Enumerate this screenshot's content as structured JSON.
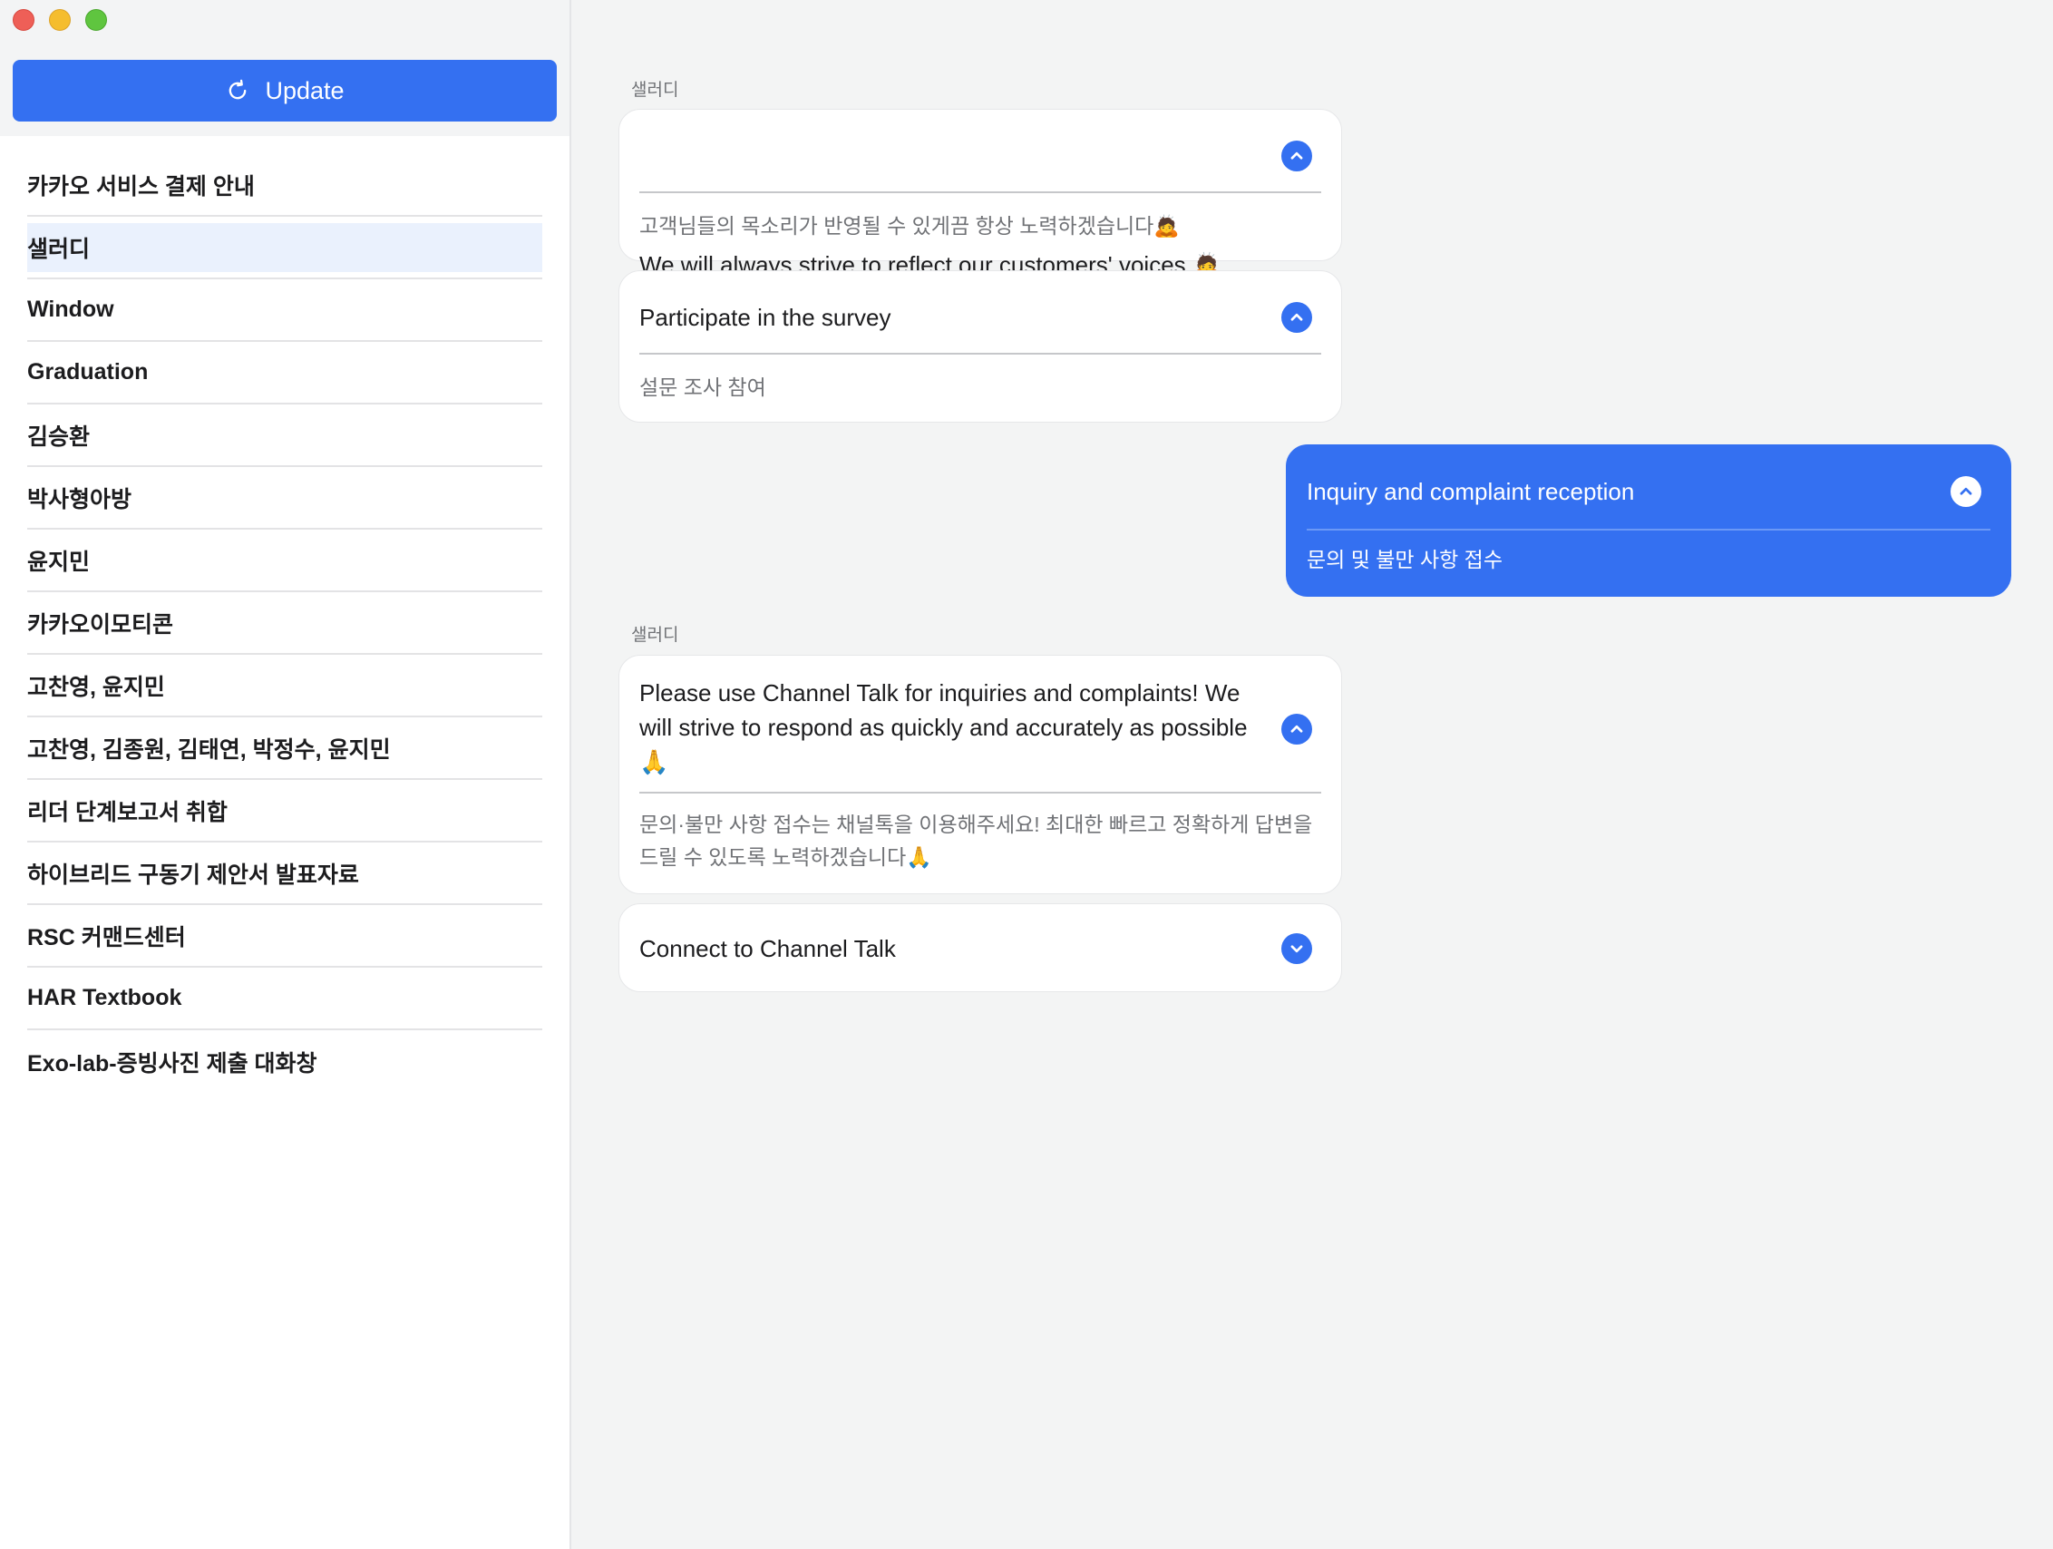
{
  "sidebar": {
    "update_label": "Update",
    "update_icon": "refresh-icon",
    "items": [
      {
        "label": "카카오 서비스 결제 안내"
      },
      {
        "label": "샐러디",
        "selected": true
      },
      {
        "label": "Window"
      },
      {
        "label": "Graduation"
      },
      {
        "label": "김승환"
      },
      {
        "label": "박사형아방"
      },
      {
        "label": "윤지민"
      },
      {
        "label": "카카오이모티콘"
      },
      {
        "label": "고찬영, 윤지민"
      },
      {
        "label": "고찬영, 김종원, 김태연, 박정수, 윤지민"
      },
      {
        "label": "리더 단계보고서 취합"
      },
      {
        "label": "하이브리드 구동기 제안서 발표자료"
      },
      {
        "label": "RSC 커맨드센터"
      },
      {
        "label": "HAR Textbook"
      },
      {
        "label": "Exo-lab-증빙사진 제출 대화창"
      }
    ]
  },
  "chat": {
    "sender_1": "샐러디",
    "msg_1": {
      "title": "We will always strive to reflect our customers' voices 🙇",
      "sub": "고객님들의 목소리가 반영될 수 있게끔 항상 노력하겠습니다🙇"
    },
    "msg_2": {
      "title": "Participate in the survey",
      "sub": "설문 조사 참여"
    },
    "msg_3": {
      "title": "Inquiry and complaint reception",
      "sub": "문의 및 불만 사항 접수"
    },
    "sender_2": "샐러디",
    "msg_4": {
      "title": "Please use Channel Talk for inquiries and complaints! We will strive to respond as quickly and accurately as possible 🙏",
      "sub": "문의·불만 사항 접수는 채널톡을 이용해주세요! 최대한 빠르고 정확하게 답변을 드릴 수 있도록 노력하겠습니다🙏"
    },
    "msg_5": {
      "title": "Connect to Channel Talk"
    }
  },
  "colors": {
    "accent": "#3470f1",
    "selected_row": "#eaf1fd",
    "background": "#f3f4f4"
  }
}
